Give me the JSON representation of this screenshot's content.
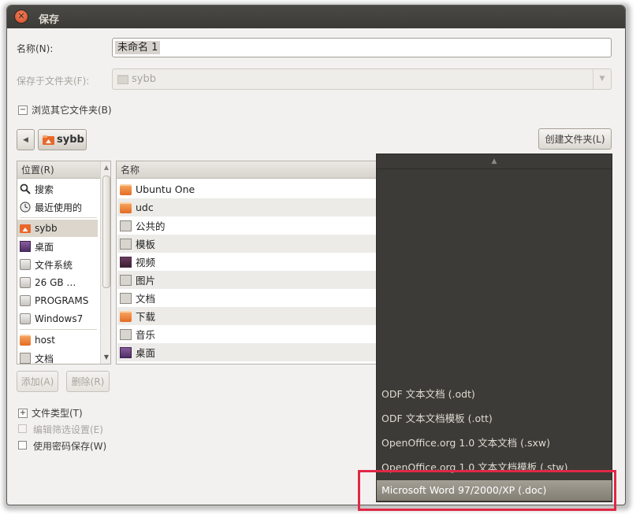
{
  "window": {
    "title": "保存"
  },
  "name_row": {
    "label": "名称(N):",
    "value": "未命名 1"
  },
  "folder_row": {
    "label": "保存于文件夹(F):",
    "value": "sybb"
  },
  "browse": {
    "label": "浏览其它文件夹(B)"
  },
  "path_bar": {
    "current": "sybb",
    "create_folder_label": "创建文件夹(L)"
  },
  "places": {
    "header": "位置(R)",
    "items": [
      {
        "label": "搜索",
        "icon": "search-icon"
      },
      {
        "label": "最近使用的",
        "icon": "clock-icon"
      },
      {
        "label": "sybb",
        "icon": "home-folder-icon"
      },
      {
        "label": "桌面",
        "icon": "desktop-icon"
      },
      {
        "label": "文件系统",
        "icon": "drive-icon"
      },
      {
        "label": "26 GB …",
        "icon": "drive-icon"
      },
      {
        "label": "PROGRAMS",
        "icon": "drive-icon"
      },
      {
        "label": "Windows7",
        "icon": "drive-icon"
      },
      {
        "label": "host",
        "icon": "folder-icon"
      },
      {
        "label": "文档",
        "icon": "documents-icon"
      }
    ],
    "add_label": "添加(A)",
    "remove_label": "删除(R)"
  },
  "files": {
    "header": "名称",
    "items": [
      {
        "label": "Ubuntu One",
        "icon": "folder-icon"
      },
      {
        "label": "udc",
        "icon": "folder-icon"
      },
      {
        "label": "公共的",
        "icon": "public-folder-icon"
      },
      {
        "label": "模板",
        "icon": "templates-folder-icon"
      },
      {
        "label": "视频",
        "icon": "videos-folder-icon"
      },
      {
        "label": "图片",
        "icon": "pictures-folder-icon"
      },
      {
        "label": "文档",
        "icon": "documents-folder-icon"
      },
      {
        "label": "下载",
        "icon": "downloads-folder-icon"
      },
      {
        "label": "音乐",
        "icon": "music-folder-icon"
      },
      {
        "label": "桌面",
        "icon": "desktop-folder-icon"
      }
    ]
  },
  "file_type": {
    "label": "文件类型(T)"
  },
  "options": {
    "edit_filter": "编辑筛选设置(E)",
    "save_with_password": "使用密码保存(W)"
  },
  "type_dropdown": {
    "items": [
      "ODF 文本文档 (.odt)",
      "ODF 文本文档模板 (.ott)",
      "OpenOffice.org 1.0 文本文档 (.sxw)",
      "OpenOffice.org 1.0 文本文档模板 (.stw)",
      "Microsoft Word 97/2000/XP (.doc)"
    ],
    "selected": "Microsoft Word 97/2000/XP (.doc)"
  },
  "colors": {
    "titlebar": "#3c3b37",
    "dropdown_bg": "#3c3b37",
    "selection": "#a49f95",
    "highlight_box": "#e02845",
    "close_button": "#e05a2b"
  }
}
